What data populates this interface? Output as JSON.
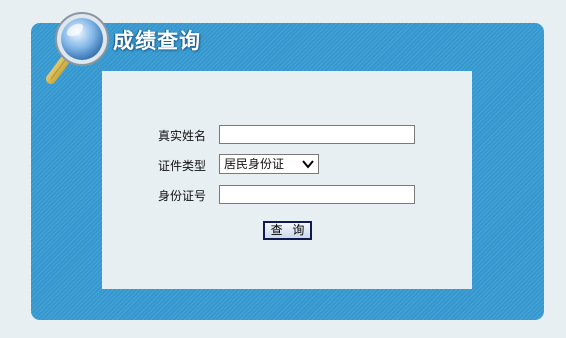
{
  "header": {
    "title": "成绩查询",
    "icon": "magnifier-icon"
  },
  "form": {
    "name_label": "真实姓名",
    "name_value": "",
    "id_type_label": "证件类型",
    "id_type_selected": "居民身份证",
    "id_number_label": "身份证号",
    "id_number_value": "",
    "query_button": "查 询"
  },
  "colors": {
    "panel": "#3497cf",
    "background": "#e8eff3",
    "button_border": "#101a50"
  }
}
